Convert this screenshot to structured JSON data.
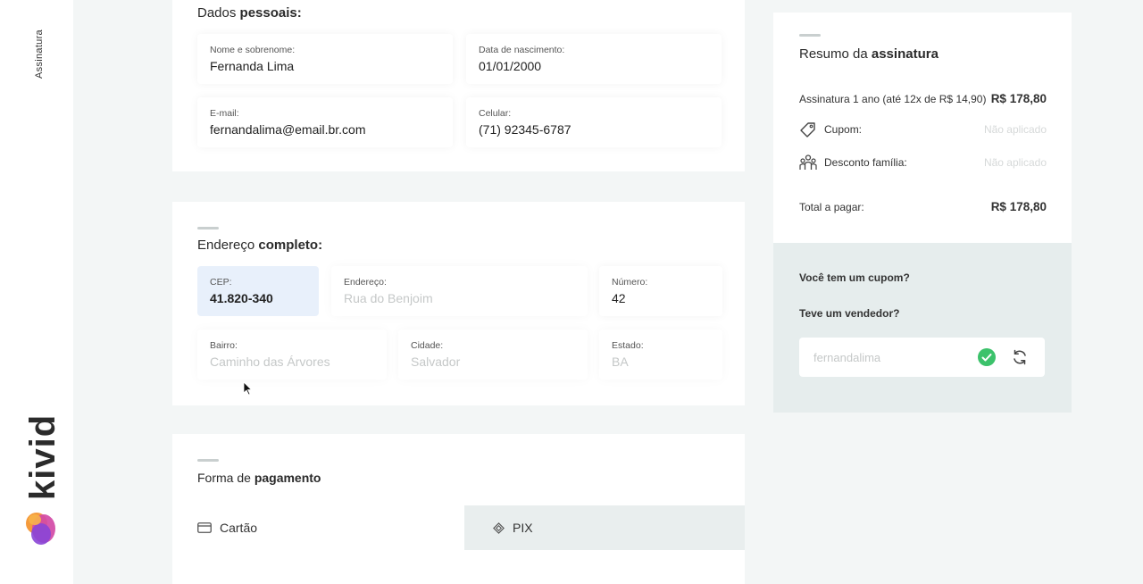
{
  "sidebar": {
    "section_label": "Assinatura",
    "brand": "kivid"
  },
  "personal": {
    "title_regular": "Dados ",
    "title_bold": "pessoais:",
    "fields": [
      {
        "label": "Nome e sobrenome:",
        "value": "Fernanda Lima"
      },
      {
        "label": "Data de nascimento:",
        "value": "01/01/2000"
      },
      {
        "label": "E-mail:",
        "value": "fernandalima@email.br.com"
      },
      {
        "label": "Celular:",
        "value": "(71) 92345-6787"
      }
    ]
  },
  "address": {
    "title_regular": "Endereço ",
    "title_bold": "completo:",
    "fields": [
      {
        "label": "CEP:",
        "value": "41.820-340"
      },
      {
        "label": "Endereço:",
        "value": "Rua do Benjoim"
      },
      {
        "label": "Número:",
        "value": "42"
      },
      {
        "label": "Bairro:",
        "value": "Caminho das Árvores"
      },
      {
        "label": "Cidade:",
        "value": "Salvador"
      },
      {
        "label": "Estado:",
        "value": "BA"
      }
    ]
  },
  "payment": {
    "title_regular": "Forma de ",
    "title_bold": "pagamento",
    "options": [
      {
        "label": "Cartão",
        "icon": "credit-card-icon"
      },
      {
        "label": "PIX",
        "icon": "pix-icon",
        "selected": true
      }
    ]
  },
  "summary": {
    "title_regular": "Resumo da ",
    "title_bold": "assinatura",
    "plan_label": "Assinatura 1 ano (até 12x de R$ 14,90)",
    "plan_price": "R$ 178,80",
    "coupon_label": "Cupom:",
    "coupon_status": "Não aplicado",
    "family_label": "Desconto família:",
    "family_status": "Não aplicado",
    "total_label": "Total a pagar:",
    "total_price": "R$ 178,80"
  },
  "coupon": {
    "question_coupon": "Você tem um cupom?",
    "question_seller": "Teve um vendedor?",
    "seller_value": "fernandalima"
  },
  "colors": {
    "accent_green": "#3cc26b",
    "cep_highlight": "#e8f0fb",
    "selected_tab": "#e9eeee"
  }
}
